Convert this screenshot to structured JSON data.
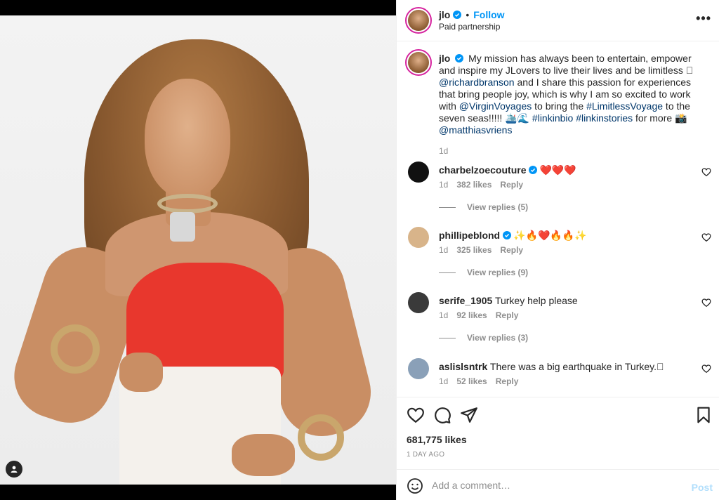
{
  "header": {
    "username": "jlo",
    "separator": "•",
    "follow_label": "Follow",
    "subtitle": "Paid partnership",
    "more_label": "•••"
  },
  "caption": {
    "username": "jlo",
    "parts": [
      {
        "text": "My mission has always been to entertain, empower and inspire my JLovers to live their lives and be limitless 🏻 ",
        "link": false
      },
      {
        "text": "@richardbranson",
        "link": true
      },
      {
        "text": " and I share this passion for experiences that bring people joy, which is why I am so excited to work with ",
        "link": false
      },
      {
        "text": "@VirginVoyages",
        "link": true
      },
      {
        "text": " to bring the ",
        "link": false
      },
      {
        "text": "#LimitlessVoyage",
        "link": true
      },
      {
        "text": " to the seven seas!!!!! 🛳️🌊 ",
        "link": false
      },
      {
        "text": "#linkinbio",
        "link": true
      },
      {
        "text": " ",
        "link": false
      },
      {
        "text": "#linkinstories",
        "link": true
      },
      {
        "text": " for more 📸 ",
        "link": false
      },
      {
        "text": "@matthiasvriens",
        "link": true
      }
    ],
    "time": "1d"
  },
  "comments": [
    {
      "username": "charbelzoecouture",
      "verified": true,
      "text": "❤️❤️❤️",
      "time": "1d",
      "likes": "382 likes",
      "reply": "Reply",
      "view_replies": "View replies (5)",
      "avatar_color": "#111111"
    },
    {
      "username": "phillipeblond",
      "verified": true,
      "text": "✨🔥❤️🔥🔥✨",
      "time": "1d",
      "likes": "325 likes",
      "reply": "Reply",
      "view_replies": "View replies (9)",
      "avatar_color": "#d8b48a"
    },
    {
      "username": "serife_1905",
      "verified": false,
      "text": "Turkey help please",
      "time": "1d",
      "likes": "92 likes",
      "reply": "Reply",
      "view_replies": "View replies (3)",
      "avatar_color": "#3a3a3a"
    },
    {
      "username": "aslislsntrk",
      "verified": false,
      "text": "There was a big earthquake in Turkey.🏻",
      "time": "1d",
      "likes": "52 likes",
      "reply": "Reply",
      "view_replies": "",
      "avatar_color": "#8aa0b8"
    }
  ],
  "stats": {
    "likes": "681,775 likes",
    "ago": "1 DAY AGO"
  },
  "add_comment": {
    "placeholder": "Add a comment…",
    "post_label": "Post"
  },
  "colors": {
    "accent": "#0095f6",
    "link": "#00376b",
    "post_disabled": "#b2dffc",
    "muted": "#8e8e8e"
  }
}
